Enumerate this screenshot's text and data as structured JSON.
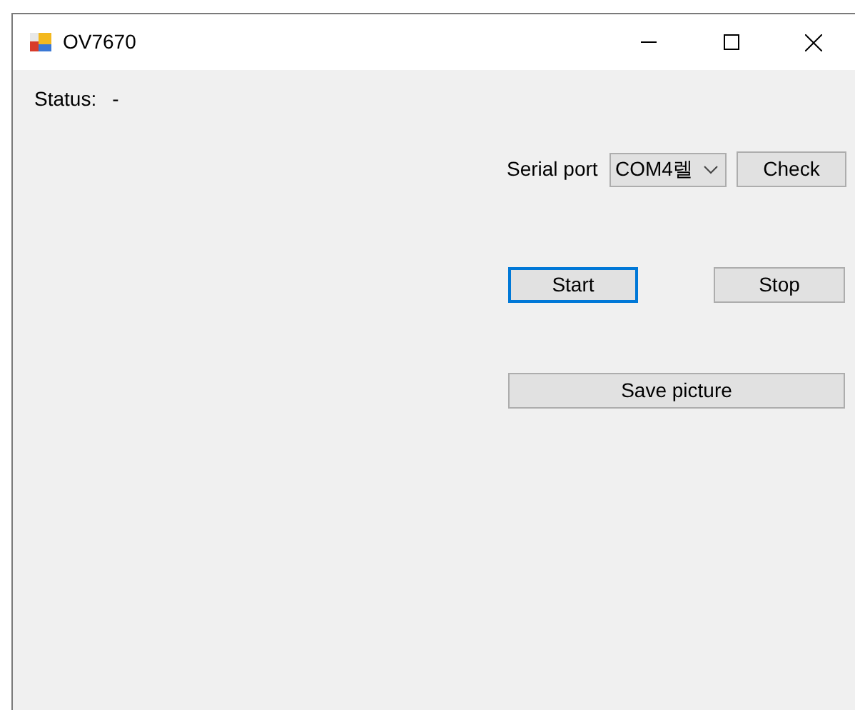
{
  "window": {
    "title": "OV7670"
  },
  "status": {
    "label": "Status:",
    "value": "-"
  },
  "serial_port": {
    "label": "Serial port",
    "value": "COM4렐",
    "check_button": "Check"
  },
  "buttons": [
    {
      "label": "Start",
      "focused": true
    },
    {
      "label": "Stop",
      "focused": false
    }
  ],
  "save_button": "Save picture"
}
